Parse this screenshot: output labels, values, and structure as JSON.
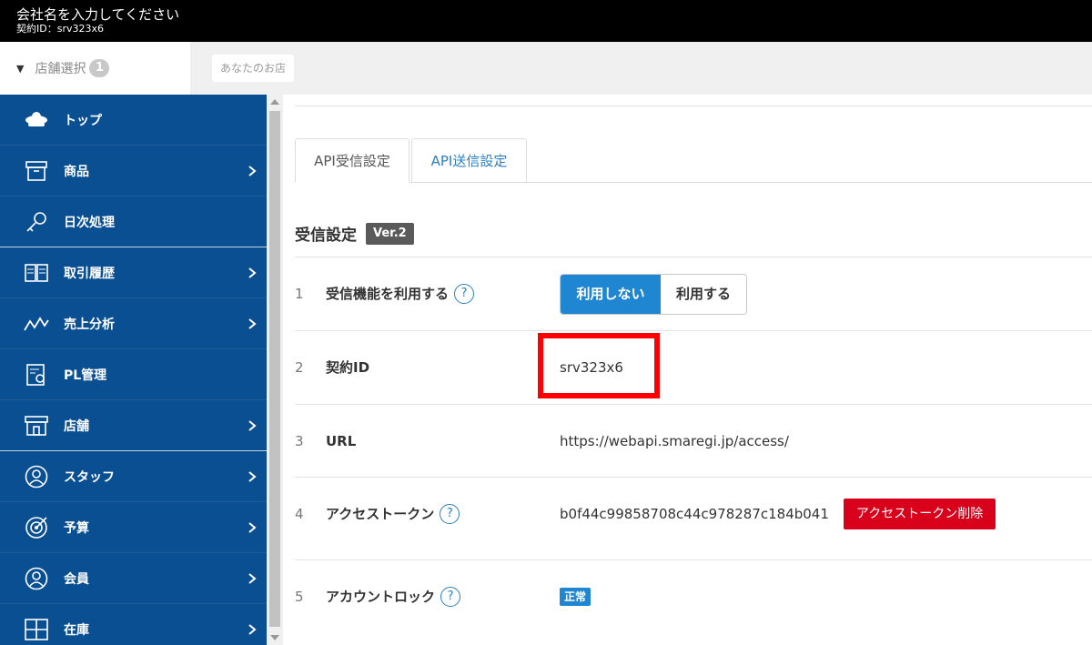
{
  "topbar": {
    "company": "会社名を入力してください",
    "contract": "契約ID：srv323x6"
  },
  "store_selector": {
    "label": "店舗選択",
    "count": "1",
    "chip": "あなたのお店"
  },
  "sidebar": {
    "items": [
      {
        "label": "トップ",
        "icon": "cloud-icon"
      },
      {
        "label": "商品",
        "icon": "box-icon"
      },
      {
        "label": "日次処理",
        "icon": "key-icon"
      },
      {
        "label": "取引履歴",
        "icon": "book-icon"
      },
      {
        "label": "売上分析",
        "icon": "line-graph-icon"
      },
      {
        "label": "PL管理",
        "icon": "report-icon"
      },
      {
        "label": "店舗",
        "icon": "storefront-icon"
      },
      {
        "label": "スタッフ",
        "icon": "person-circle-icon"
      },
      {
        "label": "予算",
        "icon": "target-icon"
      },
      {
        "label": "会員",
        "icon": "member-icon"
      },
      {
        "label": "在庫",
        "icon": "grid-icon"
      }
    ]
  },
  "tabs": [
    {
      "label": "API受信設定",
      "active": true
    },
    {
      "label": "API送信設定",
      "active": false
    }
  ],
  "section": {
    "title": "受信設定",
    "version": "Ver.2"
  },
  "settings": {
    "row1": {
      "num": "1",
      "key": "受信機能を利用する",
      "help": "?",
      "opt_off": "利用しない",
      "opt_on": "利用する"
    },
    "row2": {
      "num": "2",
      "key": "契約ID",
      "value": "srv323x6"
    },
    "row3": {
      "num": "3",
      "key": "URL",
      "value": "https://webapi.smaregi.jp/access/"
    },
    "row4": {
      "num": "4",
      "key": "アクセストークン",
      "help": "?",
      "value": "b0f44c99858708c44c978287c184b041",
      "button": "アクセストークン削除"
    },
    "row5": {
      "num": "5",
      "key": "アカウントロック",
      "help": "?",
      "status": "正常"
    }
  },
  "colors": {
    "sidebar": "#0a4f91",
    "accent": "#1f86d1",
    "danger": "#d9001b",
    "highlight": "#ff0000"
  }
}
